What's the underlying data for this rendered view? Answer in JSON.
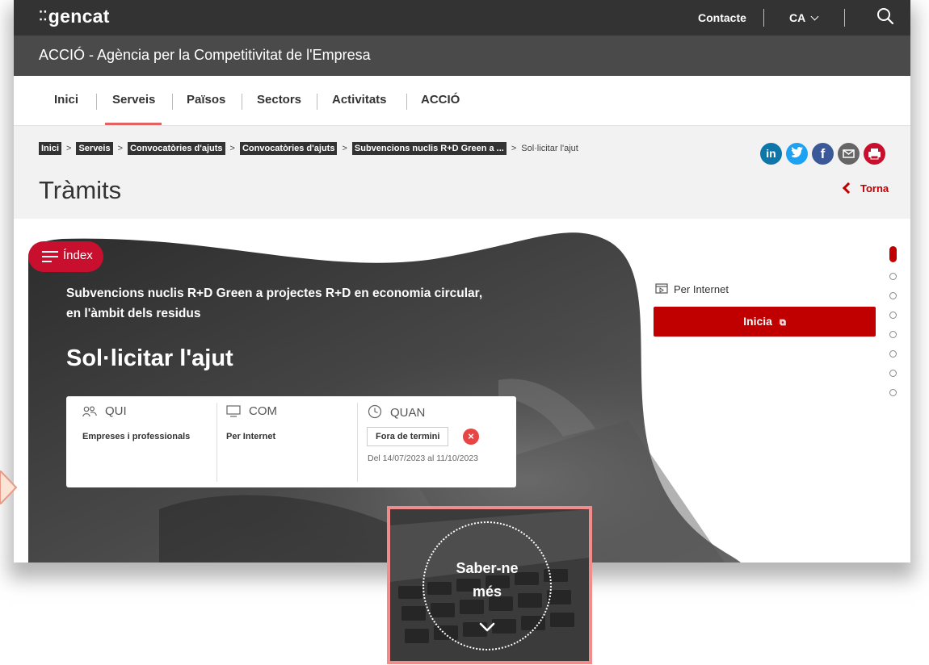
{
  "topbar": {
    "logo": "gencat",
    "contact": "Contacte",
    "language": "CA"
  },
  "agency": {
    "title": "ACCIÓ - Agència per la Competitivitat de l'Empresa"
  },
  "nav": {
    "items": [
      "Inici",
      "Serveis",
      "Països",
      "Sectors",
      "Activitats",
      "ACCIÓ"
    ],
    "active": "Serveis"
  },
  "breadcrumb": {
    "items": [
      "Inici",
      "Serveis",
      "Convocatòries d'ajuts",
      "Convocatòries d'ajuts",
      "Subvencions nuclis R+D Green a ..."
    ],
    "current": "Sol·licitar l'ajut"
  },
  "page": {
    "title": "Tràmits",
    "back": "Torna"
  },
  "social": [
    "in",
    "f"
  ],
  "colors": {
    "accent": "#c00000",
    "topbar": "#333333",
    "agency": "#4a4a4a",
    "linkedin": "#0e76a8",
    "twitter": "#1da1f2",
    "facebook": "#3b5998",
    "mail": "#666666",
    "print": "#c8102e"
  },
  "hero": {
    "index_label": "Índex",
    "procedure_name": "Subvencions nuclis R+D Green a projectes R+D en economia circular, en l'àmbit dels residus",
    "action": "Sol·licitar l'ajut",
    "who": {
      "label": "QUI",
      "value": "Empreses i professionals"
    },
    "how": {
      "label": "COM",
      "value": "Per Internet"
    },
    "when": {
      "label": "QUAN",
      "status": "Fora de termini",
      "range": "Del 14/07/2023 al 11/10/2023"
    },
    "channel": "Per Internet",
    "start_button": "Inicia"
  },
  "zoom": {
    "more_line1": "Saber-ne",
    "more_line2": "més"
  }
}
